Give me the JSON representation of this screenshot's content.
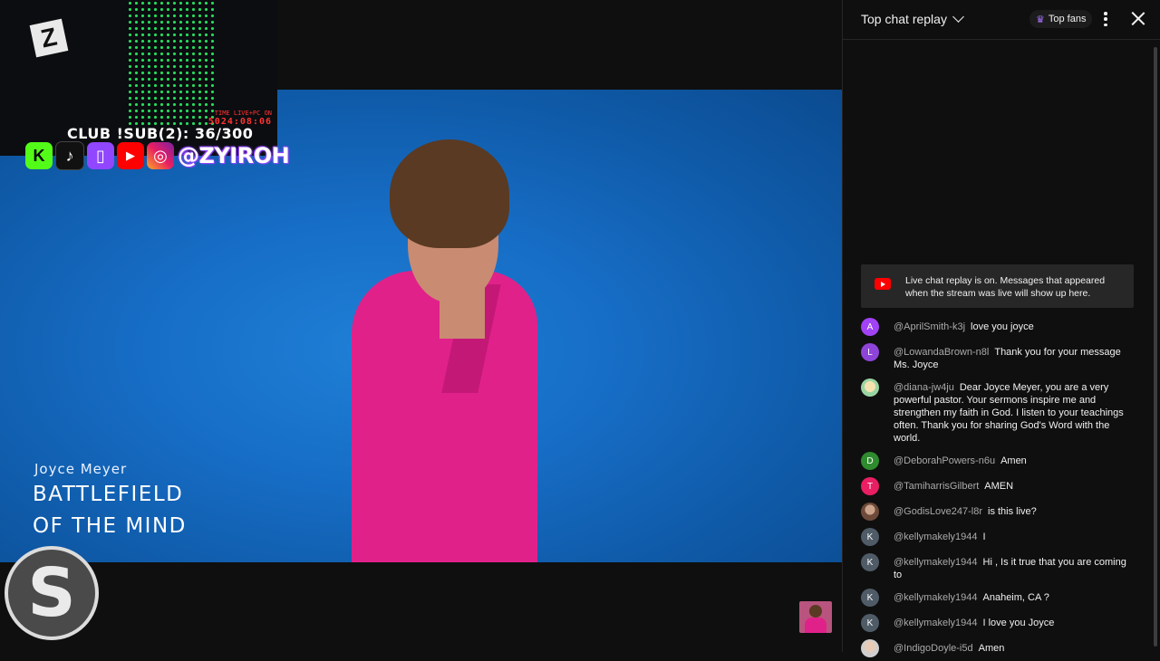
{
  "overlay": {
    "sub_counter": "CLUB !SUB(2): 36/300",
    "timer_label": "TIME LIVE+PC ON",
    "timer_value": "5024:08:06",
    "handle": "@ZYIROH",
    "social_icons": [
      "kick-icon",
      "tiktok-icon",
      "twitch-icon",
      "youtube-icon",
      "instagram-icon"
    ],
    "brand_logo": "S"
  },
  "video": {
    "caption_author": "Joyce Meyer",
    "caption_title_1": "BATTLEFIELD",
    "caption_title_2": "OF THE MIND"
  },
  "chat": {
    "title": "Top chat replay",
    "top_fans_label": "Top fans",
    "notice": "Live chat replay is on. Messages that appeared when the stream was live will show up here.",
    "messages": [
      {
        "initial": "A",
        "color": "#a142f4",
        "author": "@AprilSmith-k3j",
        "text": "love you joyce"
      },
      {
        "initial": "L",
        "color": "#8e44d8",
        "author": "@LowandaBrown-n8l",
        "text": "Thank you for your message Ms. Joyce"
      },
      {
        "initial": "",
        "color": "#9ad4a3",
        "author": "@diana-jw4ju",
        "text": "Dear Joyce Meyer, you are a very powerful pastor. Your sermons inspire me and strengthen my faith in God. I listen to your teachings often. Thank you for sharing God's Word with the world."
      },
      {
        "initial": "D",
        "color": "#2e8b2e",
        "author": "@DeborahPowers-n6u",
        "text": "Amen"
      },
      {
        "initial": "T",
        "color": "#e91e63",
        "author": "@TamiharrisGilbert",
        "text": "AMEN"
      },
      {
        "initial": "",
        "color": "#6e4a3a",
        "author": "@GodisLove247-l8r",
        "text": "is this live?"
      },
      {
        "initial": "K",
        "color": "#4f5b66",
        "author": "@kellymakely1944",
        "text": "I"
      },
      {
        "initial": "K",
        "color": "#4f5b66",
        "author": "@kellymakely1944",
        "text": "Hi , Is it true that you are coming to"
      },
      {
        "initial": "K",
        "color": "#4f5b66",
        "author": "@kellymakely1944",
        "text": "Anaheim, CA ?"
      },
      {
        "initial": "K",
        "color": "#4f5b66",
        "author": "@kellymakely1944",
        "text": "I love you Joyce"
      },
      {
        "initial": "",
        "color": "#cfcfcf",
        "author": "@IndigoDoyle-i5d",
        "text": "Amen"
      }
    ]
  }
}
